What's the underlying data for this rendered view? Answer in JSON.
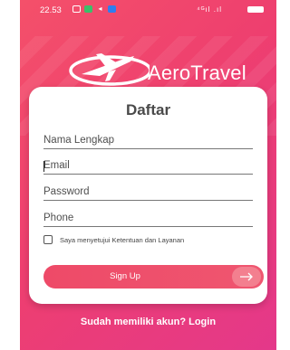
{
  "status_bar": {
    "time": "22.53",
    "signal": "⁴ᴳıl .ıl"
  },
  "logo": {
    "text": "AeroTravel"
  },
  "form": {
    "title": "Daftar",
    "fields": [
      {
        "label": "Nama Lengkap"
      },
      {
        "label": "Email"
      },
      {
        "label": "Password"
      },
      {
        "label": "Phone"
      }
    ],
    "terms_label": "Saya menyetujui Ketentuan dan Layanan",
    "submit_label": "Sign Up"
  },
  "footer": {
    "login_text": "Sudah memiliki akun? Login"
  },
  "colors": {
    "gradient_start": "#f4506a",
    "gradient_end": "#e4388a",
    "button": "#ee4a68"
  },
  "icons": [
    "airplane-logo-icon",
    "arrow-right-icon",
    "battery-icon",
    "signal-icon"
  ]
}
